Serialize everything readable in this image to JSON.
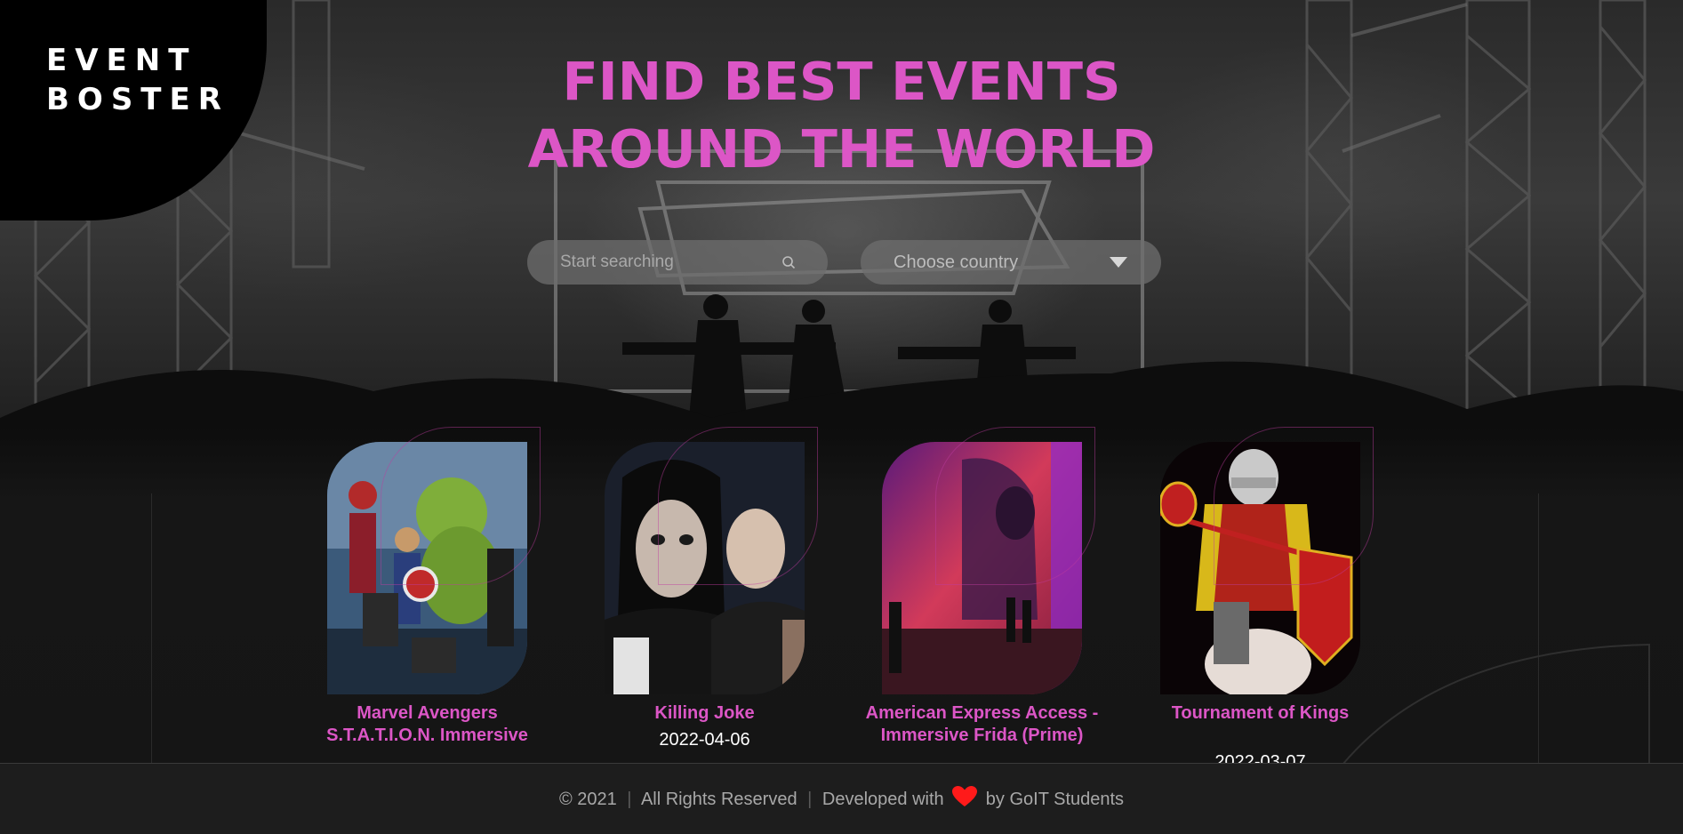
{
  "logo": {
    "line1": "EVENT",
    "line2": "BOSTER"
  },
  "hero": {
    "title_line1": "FIND BEST EVENTS",
    "title_line2": "AROUND THE WORLD"
  },
  "search": {
    "placeholder": "Start searching",
    "icon": "search-icon"
  },
  "country_select": {
    "selected": "Choose country",
    "icon": "chevron-down-icon"
  },
  "events": [
    {
      "name": "Marvel Avengers S.T.A.T.I.O.N. Immersive",
      "date": ""
    },
    {
      "name": "Killing Joke",
      "date": "2022-04-06"
    },
    {
      "name": "American Express Access - Immersive Frida (Prime)",
      "date": ""
    },
    {
      "name": "Tournament of Kings",
      "date": "2022-03-07"
    }
  ],
  "footer": {
    "copyright": "© 2021",
    "rights": "All Rights Reserved",
    "developed_with": "Developed with",
    "by": "by GoIT Students",
    "heart_icon": "heart-icon"
  },
  "colors": {
    "accent": "#dc56c6",
    "background": "#161616",
    "footer_bg": "#1d1d1d",
    "heart": "#ff1a1a"
  }
}
